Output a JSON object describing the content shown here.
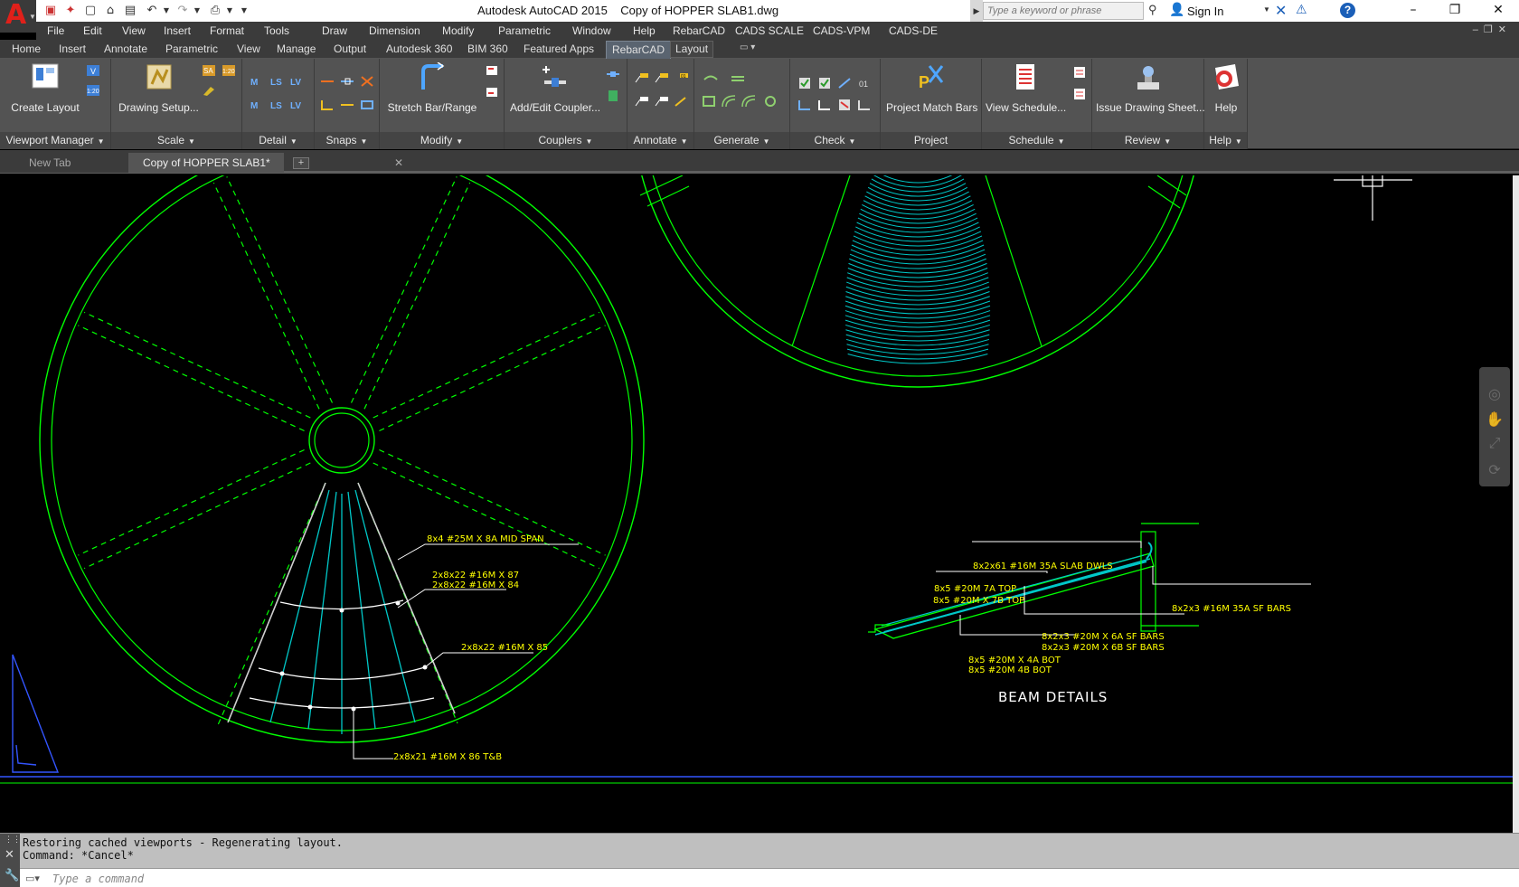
{
  "title_bar": {
    "app_title": "Autodesk AutoCAD 2015",
    "doc_title": "Copy of HOPPER SLAB1.dwg",
    "search_placeholder": "Type a keyword or phrase",
    "sign_in": "Sign In",
    "help_glyph": "?"
  },
  "menu": [
    "File",
    "Edit",
    "View",
    "Insert",
    "Format",
    "Tools",
    "Draw",
    "Dimension",
    "Modify",
    "Parametric",
    "Window",
    "Help",
    "RebarCAD",
    "CADS SCALE",
    "CADS-VPM",
    "CADS-DE"
  ],
  "ribbon_tabs": [
    "Home",
    "Insert",
    "Annotate",
    "Parametric",
    "View",
    "Manage",
    "Output",
    "Autodesk 360",
    "BIM 360",
    "Featured Apps",
    "RebarCAD",
    "Layout"
  ],
  "active_ribbon_tab": "RebarCAD",
  "ribbon_panels": {
    "viewport_manager": {
      "title": "Viewport Manager",
      "button": "Create Layout"
    },
    "scale": {
      "title": "Scale",
      "button": "Drawing Setup..."
    },
    "detail": {
      "title": "Detail"
    },
    "snaps": {
      "title": "Snaps"
    },
    "modify": {
      "title": "Modify",
      "button": "Stretch Bar/Range"
    },
    "couplers": {
      "title": "Couplers",
      "button": "Add/Edit Coupler..."
    },
    "annotate": {
      "title": "Annotate"
    },
    "generate": {
      "title": "Generate"
    },
    "check": {
      "title": "Check"
    },
    "project": {
      "title": "Project",
      "button": "Project Match Bars"
    },
    "schedule": {
      "title": "Schedule",
      "button": "View Schedule..."
    },
    "review": {
      "title": "Review",
      "button": "Issue Drawing Sheet..."
    },
    "help": {
      "title": "Help",
      "button": "Help"
    }
  },
  "doc_tabs": {
    "new_tab": "New Tab",
    "active_tab": "Copy of HOPPER SLAB1*",
    "add": "+"
  },
  "drawing": {
    "labels": {
      "mid_span": "8x4 #25M X 8A   MID SPAN",
      "b7": "2x8x22 #16M X 87",
      "b4": "2x8x22 #16M X 84",
      "b5": "2x8x22 #16M X 85",
      "b6": "2x8x21 #16M X 86   T&B",
      "slab_dwls": "8x2x61 #16M 35A   SLAB DWLS",
      "top7a": "8x5 #20M 7A   TOP",
      "top7b": "8x5 #20M X 7B   TOP",
      "sf_bars_35a": "8x2x3 #16M 35A   SF BARS",
      "sf_6a": "8x2x3 #20M X 6A   SF BARS",
      "sf_6b": "8x2x3 #20M X 6B   SF BARS",
      "bot4a": "8x5 #20M X 4A   BOT",
      "bot4b": "8x5 #20M 4B   BOT",
      "beam_title": "BEAM DETAILS"
    },
    "colors": {
      "circle": "#00ff00",
      "rebar": "#00c8c8",
      "label": "#ffff00",
      "white": "#ffffff",
      "ucs": "#3355ff"
    }
  },
  "command": {
    "history": [
      "Restoring cached viewports - Regenerating layout.",
      "Command: *Cancel*"
    ],
    "placeholder": "Type a command"
  }
}
